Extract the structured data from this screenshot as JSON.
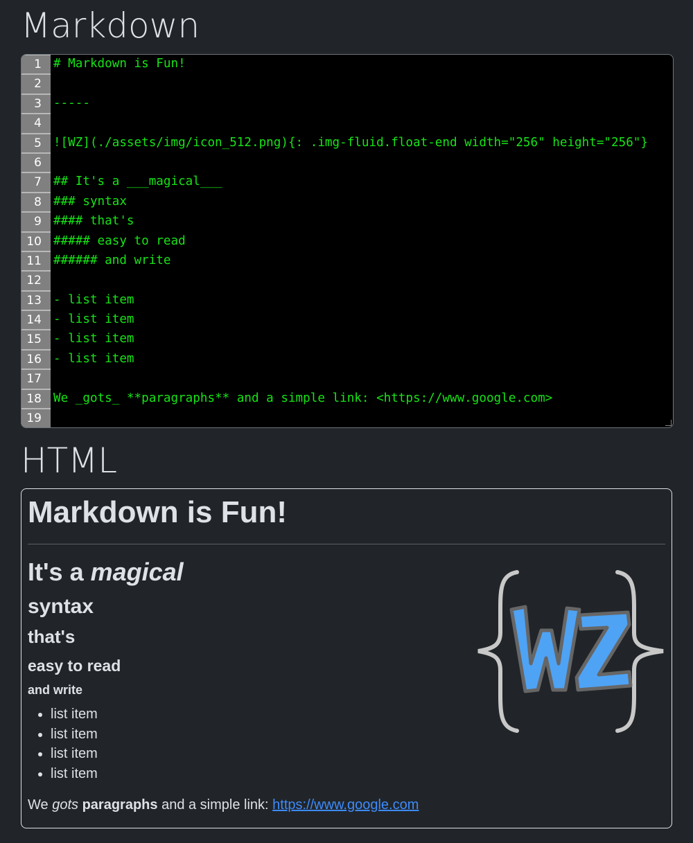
{
  "markdown_section": {
    "title": "Markdown",
    "line_numbers": [
      "1",
      "2",
      "3",
      "4",
      "5",
      "6",
      "7",
      "8",
      "9",
      "10",
      "11",
      "12",
      "13",
      "14",
      "15",
      "16",
      "17",
      "18",
      "19"
    ],
    "lines": [
      "# Markdown is Fun!",
      "",
      "-----",
      "",
      "![WZ](./assets/img/icon_512.png){: .img-fluid.float-end width=\"256\" height=\"256\"}",
      "",
      "## It's a ___magical___",
      "### syntax",
      "#### that's",
      "##### easy to read",
      "###### and write",
      "",
      "- list item",
      "- list item",
      "- list item",
      "- list item",
      "",
      "We _gots_ **paragraphs** and a simple link: <https://www.google.com>",
      ""
    ]
  },
  "html_section": {
    "title": "HTML",
    "h1": "Markdown is Fun!",
    "h2_prefix": "It's a ",
    "h2_emphasis": "magical",
    "h3": "syntax",
    "h4": "that's",
    "h5": "easy to read",
    "h6": "and write",
    "list_items": [
      "list item",
      "list item",
      "list item",
      "list item"
    ],
    "paragraph": {
      "part1": "We ",
      "italic": "gots",
      "part2": " ",
      "bold": "paragraphs",
      "part3": " and a simple link: ",
      "link": "https://www.google.com"
    },
    "image_alt": "WZ",
    "logo_text": "WZ"
  },
  "colors": {
    "background": "#212529",
    "code_text": "#17e317",
    "link": "#3d8bfd",
    "logo_fill": "#4ea3f5"
  }
}
